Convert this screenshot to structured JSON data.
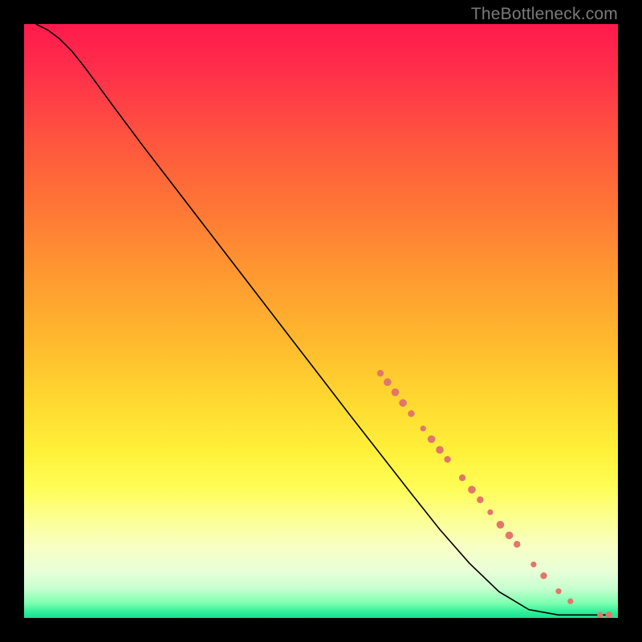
{
  "chart_data": {
    "type": "line",
    "watermark": "TheBottleneck.com",
    "title": "",
    "xlabel": "",
    "ylabel": "",
    "xlim": [
      0,
      100
    ],
    "ylim": [
      0,
      100
    ],
    "curve": [
      {
        "x": 2,
        "y": 100
      },
      {
        "x": 4,
        "y": 99
      },
      {
        "x": 6,
        "y": 97.5
      },
      {
        "x": 8,
        "y": 95.5
      },
      {
        "x": 10,
        "y": 93
      },
      {
        "x": 12,
        "y": 90.3
      },
      {
        "x": 15,
        "y": 86.2
      },
      {
        "x": 20,
        "y": 79.5
      },
      {
        "x": 25,
        "y": 73
      },
      {
        "x": 30,
        "y": 66.5
      },
      {
        "x": 35,
        "y": 60
      },
      {
        "x": 40,
        "y": 53.5
      },
      {
        "x": 45,
        "y": 47
      },
      {
        "x": 50,
        "y": 40.5
      },
      {
        "x": 55,
        "y": 34
      },
      {
        "x": 60,
        "y": 27.6
      },
      {
        "x": 65,
        "y": 21.2
      },
      {
        "x": 70,
        "y": 14.9
      },
      {
        "x": 75,
        "y": 9.2
      },
      {
        "x": 80,
        "y": 4.4
      },
      {
        "x": 85,
        "y": 1.4
      },
      {
        "x": 90,
        "y": 0.5
      },
      {
        "x": 95,
        "y": 0.5
      },
      {
        "x": 97,
        "y": 0.5
      },
      {
        "x": 98.5,
        "y": 0.5
      }
    ],
    "scatter": [
      {
        "x": 60.0,
        "y": 41.2,
        "r": 4.2
      },
      {
        "x": 61.2,
        "y": 39.7,
        "r": 4.8
      },
      {
        "x": 62.5,
        "y": 38.0,
        "r": 4.8
      },
      {
        "x": 63.8,
        "y": 36.2,
        "r": 4.8
      },
      {
        "x": 65.2,
        "y": 34.4,
        "r": 4.2
      },
      {
        "x": 67.2,
        "y": 31.9,
        "r": 3.6
      },
      {
        "x": 68.6,
        "y": 30.1,
        "r": 4.8
      },
      {
        "x": 70.0,
        "y": 28.3,
        "r": 4.8
      },
      {
        "x": 71.3,
        "y": 26.7,
        "r": 4.2
      },
      {
        "x": 73.8,
        "y": 23.6,
        "r": 4.2
      },
      {
        "x": 75.4,
        "y": 21.6,
        "r": 4.8
      },
      {
        "x": 76.8,
        "y": 19.9,
        "r": 4.2
      },
      {
        "x": 78.5,
        "y": 17.8,
        "r": 3.6
      },
      {
        "x": 80.2,
        "y": 15.7,
        "r": 4.8
      },
      {
        "x": 81.7,
        "y": 13.9,
        "r": 4.8
      },
      {
        "x": 83.0,
        "y": 12.4,
        "r": 4.2
      },
      {
        "x": 85.8,
        "y": 9.0,
        "r": 3.6
      },
      {
        "x": 87.5,
        "y": 7.1,
        "r": 4.2
      },
      {
        "x": 90.0,
        "y": 4.5,
        "r": 3.6
      },
      {
        "x": 92.0,
        "y": 2.8,
        "r": 3.6
      },
      {
        "x": 97.0,
        "y": 0.5,
        "r": 3.6
      },
      {
        "x": 98.5,
        "y": 0.5,
        "r": 4.2
      }
    ],
    "scatter_color": "#e2766b",
    "curve_color": "#000000"
  }
}
